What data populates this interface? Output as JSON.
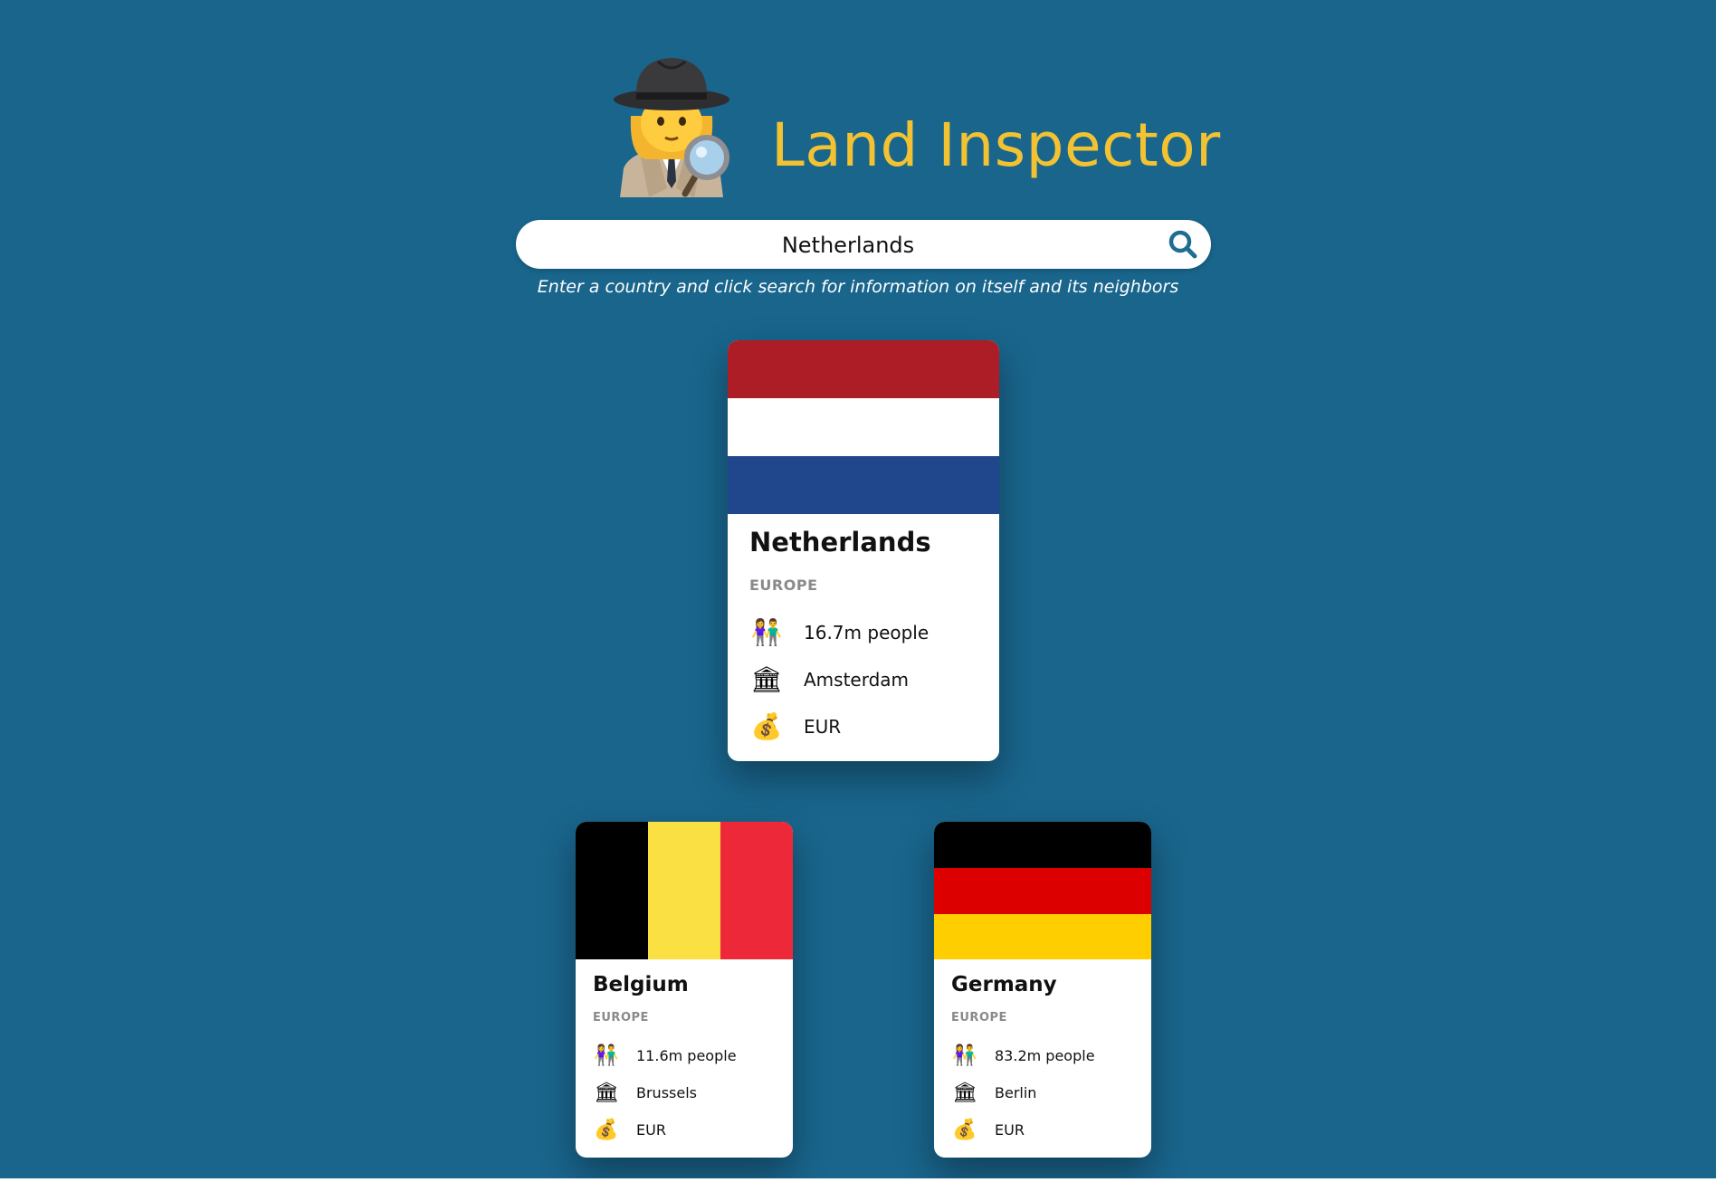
{
  "header": {
    "title": "Land Inspector",
    "logo_icon": "detective-emoji"
  },
  "search": {
    "value": "Netherlands",
    "placeholder": "",
    "button_icon": "search-icon",
    "hint": "Enter a country and click search for information on itself and its neighbors"
  },
  "colors": {
    "background": "#19658c",
    "title": "#f2c232",
    "search_icon": "#1f6e91",
    "region_text": "#8a8a8a"
  },
  "main_country": {
    "name": "Netherlands",
    "region": "EUROPE",
    "population": "16.7m people",
    "capital": "Amsterdam",
    "currency": "EUR",
    "flag": {
      "orientation": "horizontal",
      "stripes": [
        "#ad1d25",
        "#ffffff",
        "#20468b"
      ]
    },
    "icons": {
      "population": "people-holding-hands-icon",
      "capital": "classical-building-icon",
      "currency": "money-bag-icon"
    }
  },
  "neighbors": [
    {
      "name": "Belgium",
      "region": "EUROPE",
      "population": "11.6m people",
      "capital": "Brussels",
      "currency": "EUR",
      "flag": {
        "orientation": "vertical",
        "stripes": [
          "#000000",
          "#fae042",
          "#ed2939"
        ]
      }
    },
    {
      "name": "Germany",
      "region": "EUROPE",
      "population": "83.2m people",
      "capital": "Berlin",
      "currency": "EUR",
      "flag": {
        "orientation": "horizontal",
        "stripes": [
          "#000000",
          "#dd0000",
          "#ffce00"
        ]
      }
    }
  ]
}
